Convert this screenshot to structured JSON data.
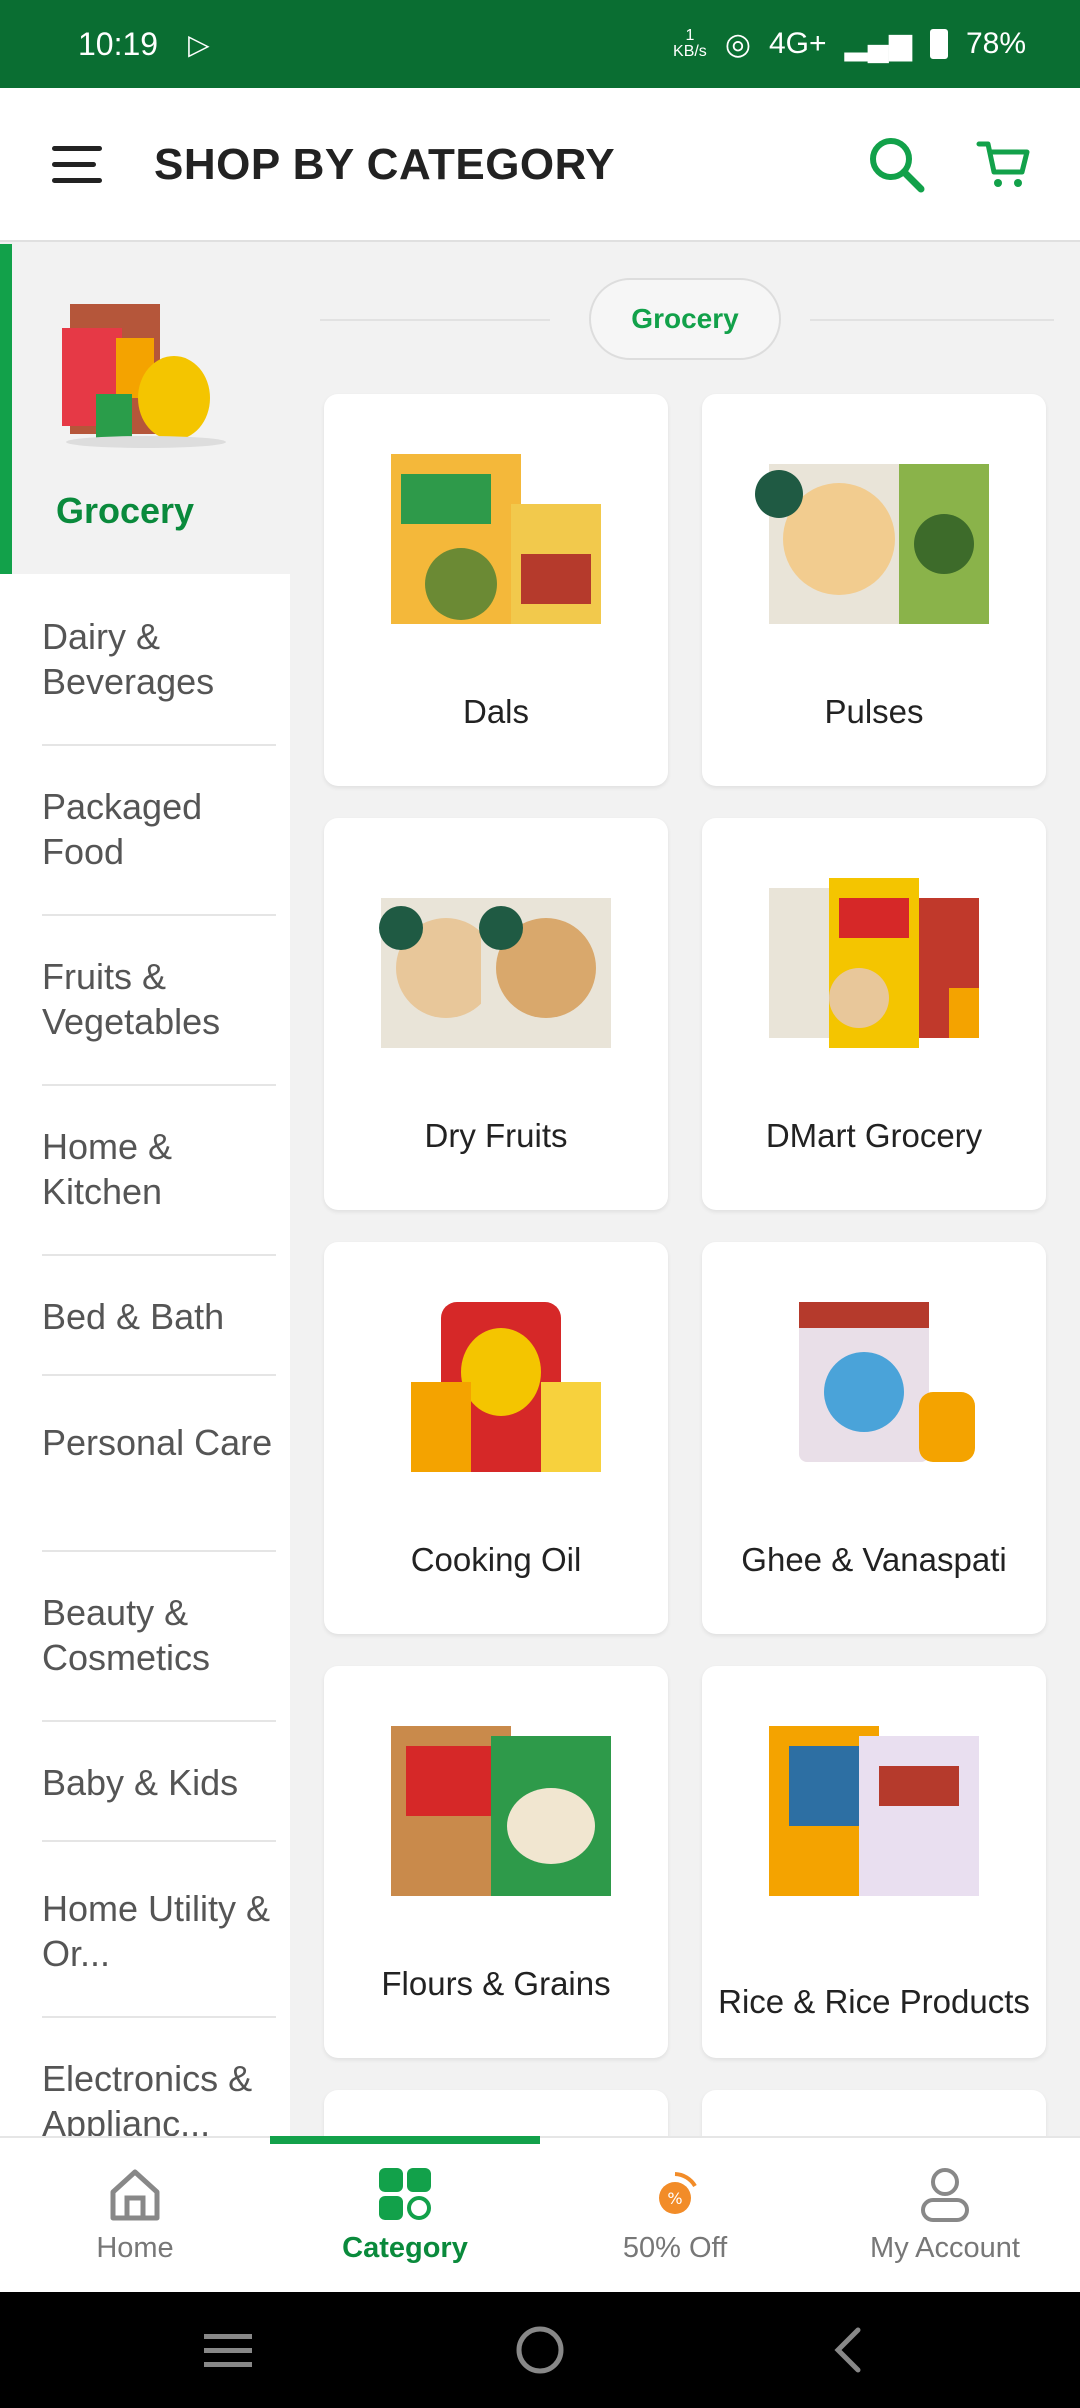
{
  "status": {
    "time": "10:19",
    "net_speed_num": "1",
    "net_speed_unit": "KB/s",
    "signal": "4G+",
    "battery": "78%"
  },
  "header": {
    "title": "SHOP BY CATEGORY"
  },
  "sidebar": {
    "active": "Grocery",
    "items": [
      "Dairy & Beverages",
      "Packaged Food",
      "Fruits & Vegetables",
      "Home & Kitchen",
      "Bed & Bath",
      "Personal Care",
      "Beauty & Cosmetics",
      "Baby & Kids",
      "Home Utility & Or...",
      "Electronics & Applianc..."
    ]
  },
  "section": {
    "pill": "Grocery"
  },
  "categories": [
    "Dals",
    "Pulses",
    "Dry Fruits",
    "DMart Grocery",
    "Cooking Oil",
    "Ghee & Vanaspati",
    "Flours & Grains",
    "Rice & Rice Products"
  ],
  "nav": {
    "home": "Home",
    "category": "Category",
    "offer": "50% Off",
    "account": "My Account"
  },
  "colors": {
    "brand": "#0a6e32",
    "accent": "#12a14a"
  }
}
